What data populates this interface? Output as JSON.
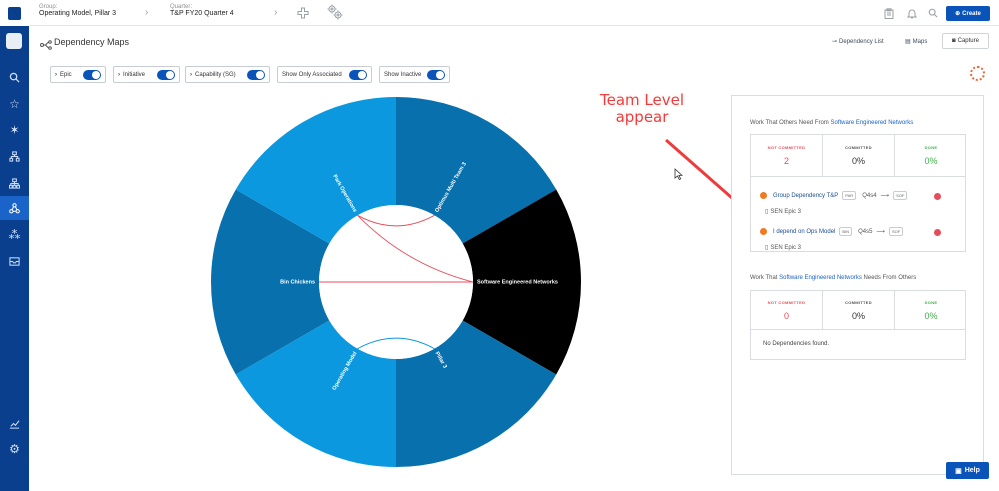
{
  "topbar": {
    "group_caption": "Group:",
    "group_value": "Operating Model, Pillar 3",
    "quarter_caption": "Quarter:",
    "quarter_value": "T&P FY20 Quarter 4",
    "create_label": "Create",
    "icons": [
      "plus-icon",
      "gears-icon",
      "clipboard-icon",
      "bell-icon",
      "search-icon"
    ]
  },
  "leftnav": {
    "icons": [
      "search-icon",
      "star-icon",
      "sparkle-icon",
      "hierarchy-icon",
      "org-chart-icon",
      "dependency-icon",
      "team-icon",
      "inbox-icon",
      "analytics-icon",
      "settings-icon"
    ],
    "active": "dependency-icon"
  },
  "page": {
    "title": "Dependency Maps",
    "links": {
      "dependency_list": "Dependency List",
      "maps": "Maps",
      "capture": "Capture"
    }
  },
  "filters": [
    {
      "label": "Epic",
      "toggle": true,
      "expandable": true
    },
    {
      "label": "Initiative",
      "toggle": true,
      "expandable": true
    },
    {
      "label": "Capability (SG)",
      "toggle": true,
      "expandable": true
    },
    {
      "label": "Show Only Associated",
      "toggle": true,
      "expandable": false
    },
    {
      "label": "Show Inactive",
      "toggle": true,
      "expandable": false
    }
  ],
  "wheel": {
    "segments": [
      {
        "name": "Bin Chickens",
        "color": "#0870ad"
      },
      {
        "name": "Park Operations",
        "color": "#0b98de"
      },
      {
        "name": "Optimus Multi Team 3",
        "color": "#0870ad"
      },
      {
        "name": "Software Engineered Networks",
        "color": "#000000"
      },
      {
        "name": "Pillar 3",
        "color": "#0870ad"
      },
      {
        "name": "Operating Model",
        "color": "#0b98de"
      }
    ],
    "links": [
      {
        "from": "Bin Chickens",
        "to": "Software Engineered Networks",
        "color": "#e84c5a"
      },
      {
        "from": "Park Operations",
        "to": "Optimus Multi Team 3",
        "color": "#e84c5a"
      },
      {
        "from": "Park Operations",
        "to": "Software Engineered Networks",
        "color": "#e84c5a"
      },
      {
        "from": "Operating Model",
        "to": "Pillar 3",
        "color": "#0b98de"
      }
    ]
  },
  "panel": {
    "others_need": {
      "title_pre": "Work That Others Need From",
      "title_link": "Software Engineered Networks",
      "stats": [
        {
          "label": "NOT COMMITTED",
          "value": "2",
          "color": "#e84c5a"
        },
        {
          "label": "COMMITTED",
          "value": "0%",
          "color": "#333333"
        },
        {
          "label": "DONE",
          "value": "0%",
          "color": "#3fae49"
        }
      ],
      "items": [
        {
          "title": "Group Dependency T&P",
          "tag1": "PAR",
          "quarter": "Q4s4",
          "tag2": "SOF",
          "epic": "SEN Epic 3"
        },
        {
          "title": "I depend on Ops Model",
          "tag1": "BIN",
          "quarter": "Q4s5",
          "tag2": "SOF",
          "epic": "SEN Epic 3"
        }
      ]
    },
    "needs_from_others": {
      "title_pre": "Work That",
      "title_link": "Software Engineered Networks",
      "title_post": "Needs From Others",
      "stats": [
        {
          "label": "NOT COMMITTED",
          "value": "0",
          "color": "#e84c5a"
        },
        {
          "label": "COMMITTED",
          "value": "0%",
          "color": "#333333"
        },
        {
          "label": "DONE",
          "value": "0%",
          "color": "#3fae49"
        }
      ],
      "empty_text": "No Dependencies found."
    }
  },
  "annotation": {
    "line1": "Team Level",
    "line2": "appear",
    "color": "#ef3b3b"
  },
  "help_label": "Help"
}
